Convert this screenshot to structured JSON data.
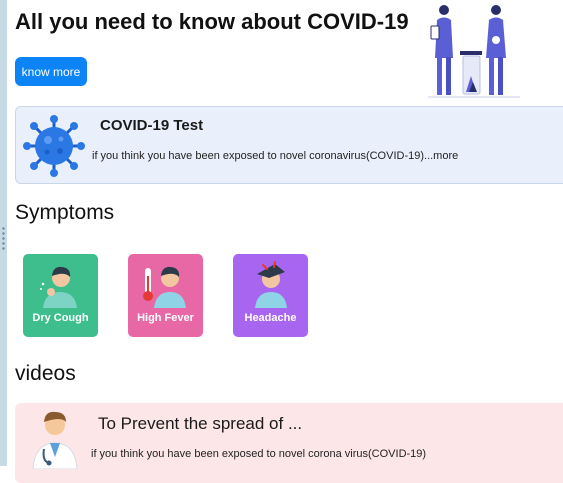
{
  "hero": {
    "title": "All you need to know about COVID-19",
    "button_label": "know more"
  },
  "test_card": {
    "title": "COVID-19 Test",
    "description": "if you think you have been exposed to novel coronavirus(COVID-19)...more"
  },
  "symptoms": {
    "heading": "Symptoms",
    "items": [
      {
        "label": "Dry Cough",
        "color": "#3ebd8d",
        "icon": "cough-person-icon"
      },
      {
        "label": "High Fever",
        "color": "#e868a6",
        "icon": "fever-thermometer-icon"
      },
      {
        "label": "Headache",
        "color": "#a866f0",
        "icon": "headache-person-icon"
      }
    ]
  },
  "videos": {
    "heading": "videos",
    "card": {
      "title": "To Prevent the spread of ...",
      "description": "if you think you have been exposed to novel corona virus(COVID-19)"
    }
  },
  "colors": {
    "primary_button": "#0d84f6",
    "test_card_bg": "#e9f0fb",
    "video_card_bg": "#fde6e8"
  }
}
